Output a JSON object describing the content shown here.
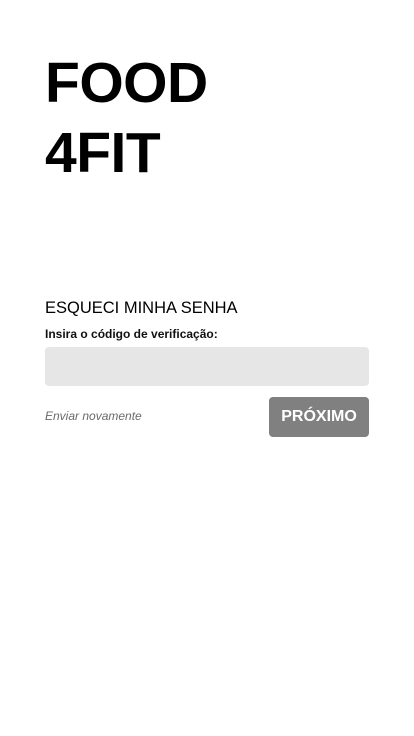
{
  "brand": {
    "line1": "FOOD",
    "line2": "4FIT"
  },
  "form": {
    "title": "ESQUECI MINHA SENHA",
    "code_label": "Insira o código de verificação:",
    "code_value": "",
    "resend_label": "Enviar novamente",
    "next_label": "PRÓXIMO"
  },
  "colors": {
    "background": "#ffffff",
    "text": "#000000",
    "input_background": "#e6e6e6",
    "button_background": "#808080",
    "button_text": "#ffffff",
    "link_text": "#6a6a6a"
  }
}
